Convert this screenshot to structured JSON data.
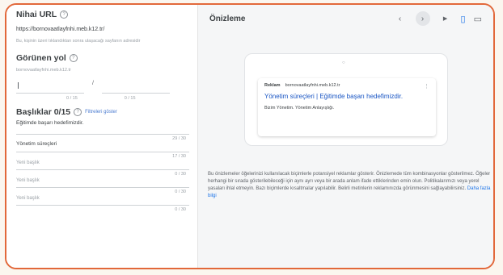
{
  "final_url": {
    "title": "Nihai URL",
    "value": "https://bornovaatlayfnhi.meb.k12.tr/",
    "hint": "Bu, kişinin üzeri tıklandıktan sonra ulaşacağı sayfanın adresidir"
  },
  "display_path": {
    "title": "Görünen yol",
    "domain": "bornovaatlayfnhi.meb.k12.tr",
    "separator": "/",
    "count1": "0 / 15",
    "count2": "0 / 15"
  },
  "headlines": {
    "title": "Başlıklar 0/15",
    "filter_link": "Filtreleri göster",
    "items": [
      {
        "value": "Eğitimde başarı hedefimizdir.",
        "placeholder": "",
        "count": "29 / 30"
      },
      {
        "value": "Yönetim süreçleri",
        "placeholder": "",
        "count": "17 / 30"
      },
      {
        "value": "",
        "placeholder": "Yeni başlık",
        "count": "0 / 30"
      },
      {
        "value": "",
        "placeholder": "Yeni başlık",
        "count": "0 / 30"
      },
      {
        "value": "",
        "placeholder": "Yeni başlık",
        "count": "0 / 30"
      }
    ]
  },
  "preview": {
    "title": "Önizleme",
    "ad_badge": "Reklam",
    "ad_domain": "bornovaatlayfnhi.meb.k12.tr",
    "ad_headline": "Yönetim süreçleri | Eğitimde başarı hedefimizdir.",
    "ad_description": "Bizim Yönetim. Yönetim Anlayışlığı.",
    "description": "Bu önizlemeler öğelerinizi kullanılacak biçimlerle potansiyel reklamlar gösterir. Önizlemede tüm kombinasyonlar gösterilmez. Öğeler herhangi bir sırada gösterilebileceği için aynı ayrı veya bir arada anlam ifade ettiklerinden emin olun. Politikalarımızı veya yerel yasaları ihlal etmeyin. Bazı biçimlerde kısaltmalar yapılabilir. Belirli metinlerin reklamınızda görünmesini sağlayabilirsiniz.",
    "more_link": "Daha fazla bilgi"
  },
  "icons": {
    "help": "?",
    "prev": "‹",
    "next": "›",
    "play": "▶",
    "mobile": "▯",
    "desktop": "▭",
    "more": "⋮"
  }
}
